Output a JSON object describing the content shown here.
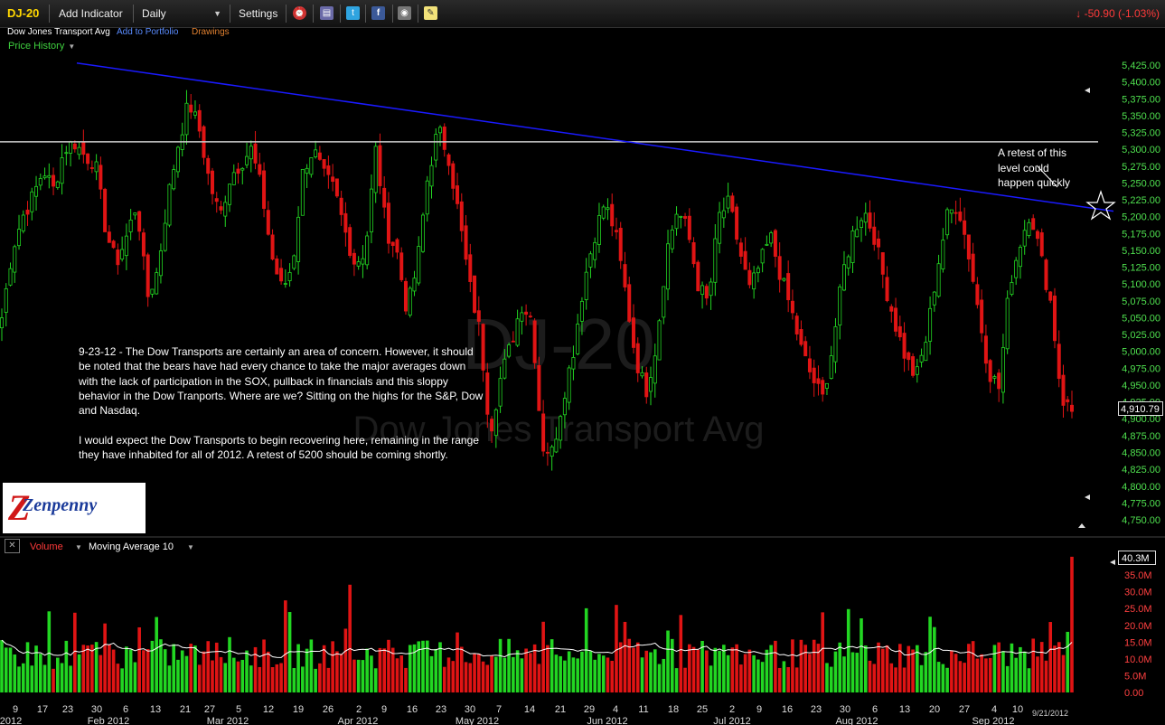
{
  "toolbar": {
    "symbol": "DJ-20",
    "add_indicator": "Add Indicator",
    "interval": "Daily",
    "settings": "Settings",
    "change": "-50.90 (-1.03%)"
  },
  "subheader": {
    "name": "Dow Jones Transport Avg",
    "add_portfolio": "Add to Portfolio",
    "drawings": "Drawings"
  },
  "panel": {
    "label": "Price History"
  },
  "watermark": {
    "symbol": "DJ-20",
    "name": "Dow Jones Transport Avg"
  },
  "note": "9-23-12 - The Dow Transports are certainly an area of concern. However, it should be noted that the bears have had every chance to take the major averages down with the lack of participation in the SOX, pullback in financials and this sloppy behavior in the Dow Tranports. Where are we? Sitting on the highs for the S&P, Dow and Nasdaq.\n\nI would expect the Dow Transports to begin recovering here, remaining in the range they have inhabited for all of 2012. A retest of 5200 should be coming shortly.",
  "annotation": "A retest of this level could happen quickly",
  "logo": {
    "text": "Zenpenny"
  },
  "volume_panel": {
    "label": "Volume",
    "ma_label": "Moving Average 10",
    "last": "40.3M"
  },
  "last_price": "4,910.79",
  "date_flag": "9/21/2012",
  "colors": {
    "up": "#22d622",
    "down": "#e01414",
    "trend": "#1a1aff",
    "level": "#cccccc",
    "ma": "#ffffff"
  },
  "chart_data": [
    {
      "type": "candlestick",
      "y_ticks": [
        "5,425.00",
        "5,400.00",
        "5,375.00",
        "5,350.00",
        "5,325.00",
        "5,300.00",
        "5,275.00",
        "5,250.00",
        "5,225.00",
        "5,200.00",
        "5,175.00",
        "5,150.00",
        "5,125.00",
        "5,100.00",
        "5,075.00",
        "5,050.00",
        "5,025.00",
        "5,000.00",
        "4,975.00",
        "4,950.00",
        "4,925.00",
        "4,900.00",
        "4,875.00",
        "4,850.00",
        "4,825.00",
        "4,800.00",
        "4,775.00",
        "4,750.00"
      ],
      "ylim": [
        4745,
        5435
      ],
      "x_day_labels": [
        "9",
        "17",
        "23",
        "30",
        "6",
        "13",
        "21",
        "27",
        "5",
        "12",
        "19",
        "26",
        "2",
        "9",
        "16",
        "23",
        "30",
        "7",
        "14",
        "21",
        "29",
        "4",
        "11",
        "18",
        "25",
        "2",
        "9",
        "16",
        "23",
        "30",
        "6",
        "13",
        "20",
        "27",
        "4",
        "10"
      ],
      "x_month_labels": [
        "2012",
        "Feb 2012",
        "Mar 2012",
        "Apr 2012",
        "May 2012",
        "Jun 2012",
        "Jul 2012",
        "Aug 2012",
        "Sep 2012"
      ],
      "horizontal_level": 5311,
      "trendline": [
        [
          5428,
          0
        ],
        [
          5208,
          1
        ]
      ],
      "close_path": [
        5050,
        5150,
        5200,
        5230,
        5270,
        5240,
        5300,
        5310,
        5290,
        5280,
        5180,
        5130,
        5170,
        5220,
        5080,
        5120,
        5230,
        5310,
        5370,
        5330,
        5250,
        5200,
        5260,
        5280,
        5300,
        5240,
        5140,
        5090,
        5130,
        5270,
        5300,
        5260,
        5240,
        5180,
        5130,
        5150,
        5300,
        5180,
        5150,
        5060,
        5130,
        5260,
        5330,
        5290,
        5200,
        5100,
        5030,
        4880,
        4960,
        5010,
        5070,
        5050,
        4860,
        4850,
        4930,
        5000,
        5100,
        5170,
        5220,
        5180,
        5090,
        4990,
        4940,
        5010,
        5150,
        5210,
        5180,
        5100,
        5070,
        5200,
        5220,
        5150,
        5090,
        5130,
        5170,
        5110,
        5060,
        5000,
        4960,
        4930,
        5010,
        5120,
        5180,
        5210,
        5170,
        5100,
        5040,
        4990,
        4960,
        5020,
        5120,
        5200,
        5220,
        5150,
        5060,
        4970,
        4945,
        5100,
        5160,
        5210,
        5140,
        5070,
        4930,
        4911
      ],
      "volume": {
        "ylim": [
          0,
          41
        ],
        "ticks": [
          "40.0M",
          "35.0M",
          "30.0M",
          "25.0M",
          "20.0M",
          "15.0M",
          "10.0M",
          "5.0M",
          "0.00"
        ]
      }
    }
  ]
}
